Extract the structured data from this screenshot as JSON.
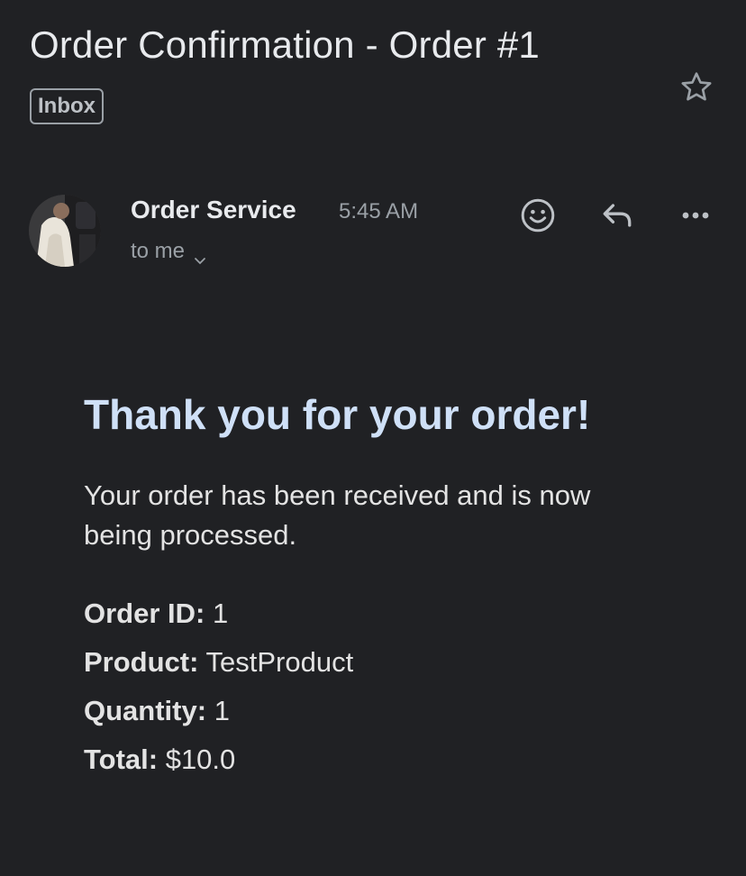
{
  "email": {
    "subject": "Order Confirmation - Order #1",
    "label": "Inbox",
    "sender": "Order Service",
    "time": "5:45 AM",
    "recipient": "to me",
    "icons": {
      "star": "star-icon",
      "emoji": "emoji-reaction-icon",
      "reply": "reply-icon",
      "more": "more-horizontal-icon",
      "chevron": "chevron-down-icon"
    }
  },
  "body": {
    "heading": "Thank you for your order!",
    "intro": "Your order has been received and is now being processed.",
    "details": [
      {
        "label": "Order ID:",
        "value": "1"
      },
      {
        "label": "Product:",
        "value": "TestProduct"
      },
      {
        "label": "Quantity:",
        "value": "1"
      },
      {
        "label": "Total:",
        "value": "$10.0"
      }
    ]
  },
  "colors": {
    "background": "#202124",
    "heading": "#cfe0f7",
    "muted": "#9aa0a6"
  }
}
